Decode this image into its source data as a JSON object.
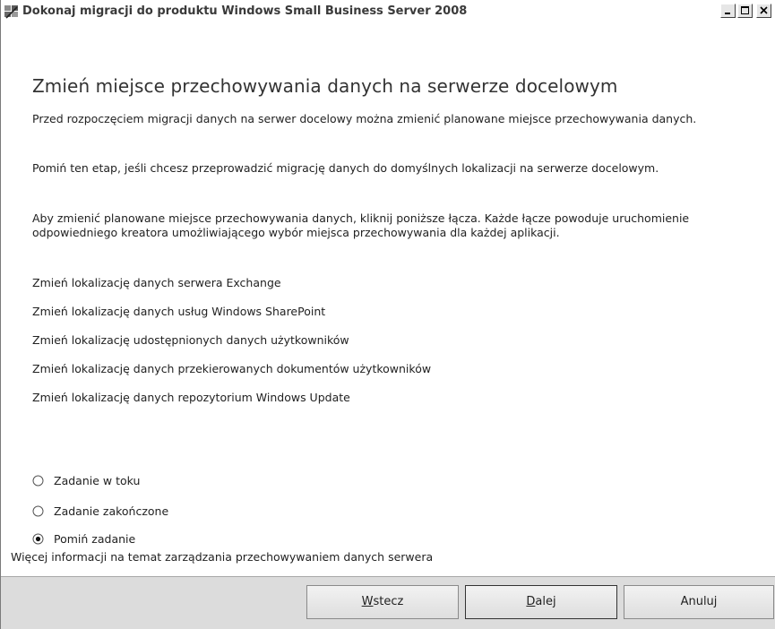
{
  "window": {
    "title": "Dokonaj migracji do produktu Windows Small Business Server 2008",
    "icon": "sbs-wizard-icon"
  },
  "content": {
    "heading": "Zmień miejsce przechowywania danych na serwerze docelowym",
    "paragraphs": [
      "Przed rozpoczęciem migracji danych na serwer docelowy można zmienić planowane miejsce przechowywania danych.",
      "Pomiń ten etap, jeśli chcesz przeprowadzić migrację danych do domyślnych lokalizacji na serwerze docelowym.",
      "Aby zmienić planowane miejsce przechowywania danych, kliknij poniższe łącza. Każde łącze powoduje uruchomienie odpowiedniego kreatora umożliwiającego wybór miejsca przechowywania dla każdej aplikacji."
    ],
    "links": [
      "Zmień lokalizację danych serwera Exchange",
      "Zmień lokalizację danych usług Windows SharePoint",
      "Zmień lokalizację udostępnionych danych użytkowników",
      "Zmień lokalizację danych przekierowanych dokumentów użytkowników",
      "Zmień lokalizację danych repozytorium Windows Update"
    ],
    "radios": [
      {
        "label": "Zadanie w toku",
        "selected": false
      },
      {
        "label": "Zadanie zakończone",
        "selected": false
      },
      {
        "label": "Pomiń zadanie",
        "selected": true
      }
    ],
    "more_info": "Więcej informacji na temat zarządzania przechowywaniem danych serwera"
  },
  "buttons": {
    "back_prefix": "W",
    "back_rest": "stecz",
    "next_prefix": "D",
    "next_rest": "alej",
    "cancel": "Anuluj"
  }
}
